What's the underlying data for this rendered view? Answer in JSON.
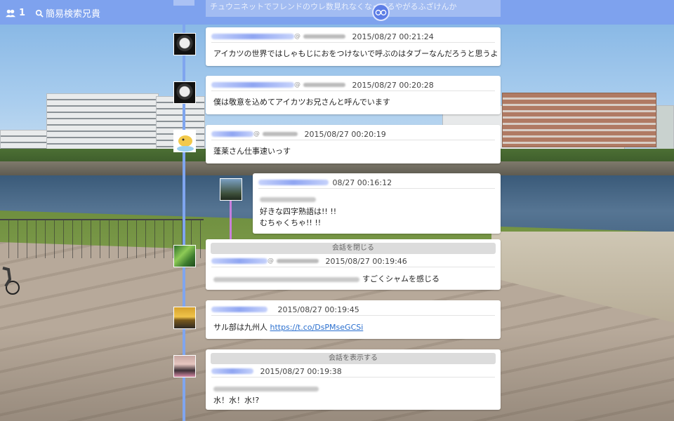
{
  "topbar": {
    "user_count": "1",
    "search_label": "簡易検索兄貴",
    "ghost_text": "チュウニネットでフレンドのウレ数見れなくなってるやがるふざけんか"
  },
  "tweets": [
    {
      "time": "2015/08/27 00:21:24",
      "text": "アイカツの世界ではしゃもじにおをつけないで呼ぶのはタブーなんだろうと思うよ"
    },
    {
      "time": "2015/08/27 00:20:28",
      "text": "僕は敬意を込めてアイカツお兄さんと呼んでいます"
    },
    {
      "time": "2015/08/27 00:20:19",
      "text": "蓬莱さん仕事速いっす"
    },
    {
      "time": "08/27 00:16:12",
      "line1": "好きな四字熟語は!! !!",
      "line2": "むちゃくちゃ!! !!"
    },
    {
      "button": "会話を閉じる",
      "time": "2015/08/27 00:19:46",
      "text": "すごくシャムを感じる"
    },
    {
      "time": "2015/08/27 00:19:45",
      "text": "サル部は九州人",
      "link": "https://t.co/DsPMseGCSi"
    },
    {
      "button": "会話を表示する",
      "time": "2015/08/27 00:19:38",
      "text": "水！水！水!?"
    }
  ],
  "colors": {
    "topbar": "#7ea2ee",
    "timeline": "#7fa5ef",
    "reply_line": "#c97fdc",
    "link": "#2a6fcf"
  },
  "icons": [
    "users-icon",
    "search-icon",
    "app-logo-icon"
  ]
}
